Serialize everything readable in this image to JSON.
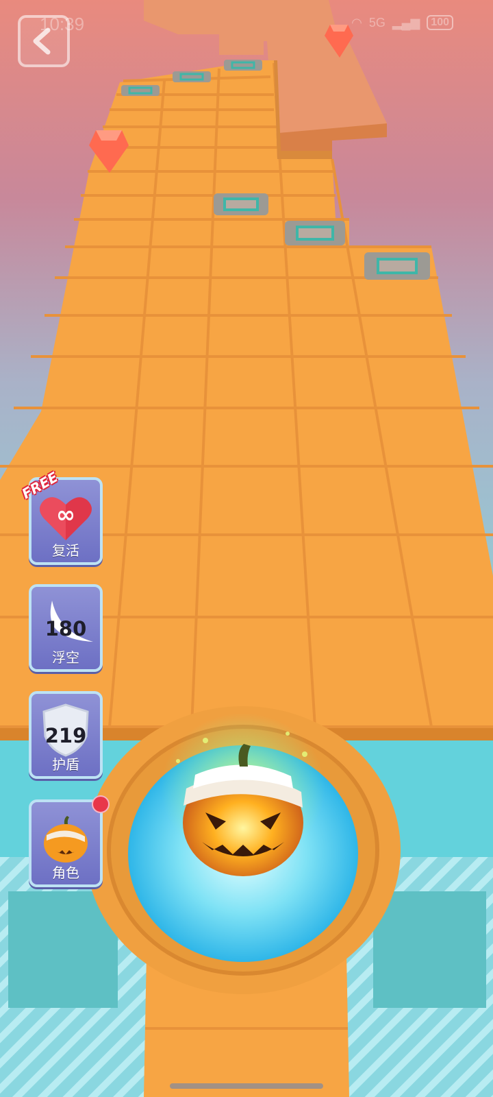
{
  "status_bar": {
    "time": "10:39",
    "network": "5G",
    "battery": "100"
  },
  "nav": {
    "back_icon": "back-arrow-icon"
  },
  "powerups": [
    {
      "label": "复活",
      "icon": "heart-infinity-icon",
      "badge": "FREE"
    },
    {
      "label": "浮空",
      "icon": "wing-icon",
      "count": "180"
    },
    {
      "label": "护盾",
      "icon": "shield-icon",
      "count": "219"
    },
    {
      "label": "角色",
      "icon": "pumpkin-character-icon"
    }
  ],
  "colors": {
    "track": "#f7a544",
    "track_grid": "#ec9636",
    "sky_top": "#e98a7e",
    "water": "#7fd3d6",
    "gem": "#ff6a50",
    "button_bg": "#7b7ecb",
    "notify": "#e8364a"
  }
}
